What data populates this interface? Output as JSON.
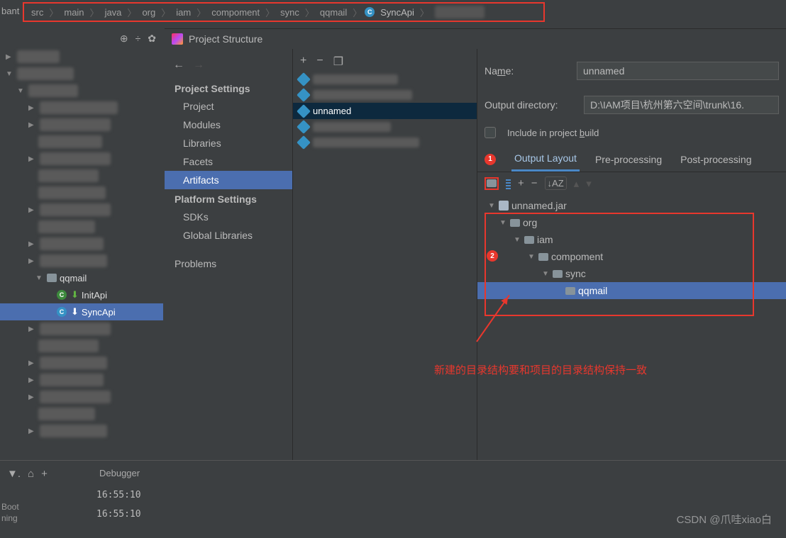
{
  "breadcrumb": [
    "src",
    "main",
    "java",
    "org",
    "iam",
    "compoment",
    "sync",
    "qqmail"
  ],
  "breadcrumb_class": "SyncApi",
  "breadcrumb_truncated": "bant",
  "dialog_title": "Project Structure",
  "nav": {
    "group1": "Project Settings",
    "items1": [
      "Project",
      "Modules",
      "Libraries",
      "Facets",
      "Artifacts"
    ],
    "group2": "Platform Settings",
    "items2": [
      "SDKs",
      "Global Libraries"
    ],
    "problems": "Problems"
  },
  "artifacts": {
    "selected": "unnamed"
  },
  "detail": {
    "name_label": "Name:",
    "name_value": "unnamed",
    "output_label": "Output directory:",
    "output_value": "D:\\IAM项目\\杭州第六空间\\trunk\\16.",
    "include_label": "Include in project build",
    "tabs": [
      "Output Layout",
      "Pre-processing",
      "Post-processing"
    ],
    "jar": "unnamed.jar",
    "tree": [
      "org",
      "iam",
      "compoment",
      "sync",
      "qqmail"
    ]
  },
  "annotation_text": "新建的目录结构要和项目的目录结构保持一致",
  "badge1": "1",
  "badge2": "2",
  "project_tree": {
    "qqmail": "qqmail",
    "initapi": "InitApi",
    "syncapi": "SyncApi"
  },
  "debug": {
    "tab": "Debugger",
    "time1": "16:55:10",
    "time2": "16:55:10",
    "side1": "Boot",
    "side2": "ning"
  },
  "watermark": "CSDN @爪哇xiao白"
}
